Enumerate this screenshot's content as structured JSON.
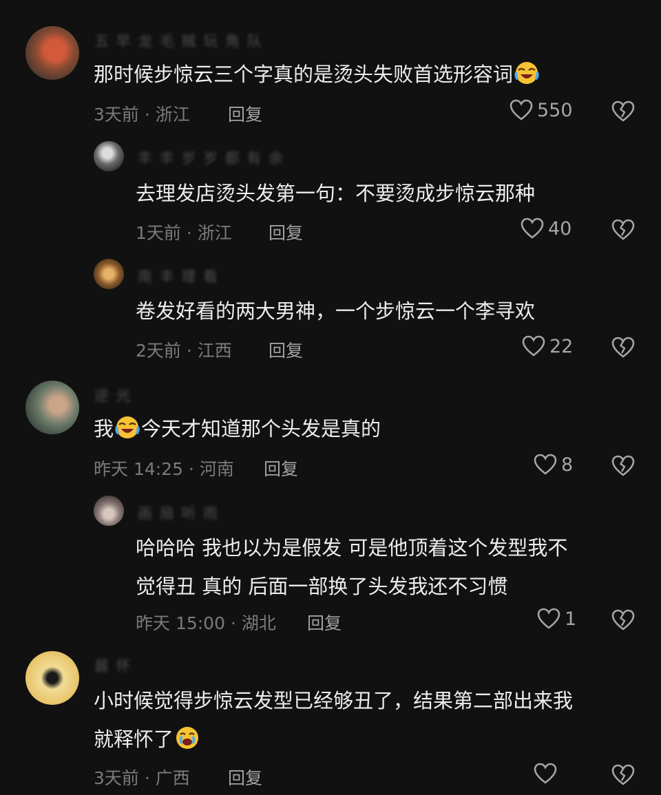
{
  "comments": [
    {
      "username": "五 早 龙 毛 贼 玩 角 队",
      "text": "那时候步惊云三个字真的是烫头失败首选形容词",
      "emoji": "laughing-crying-emoji",
      "time": "3天前 · 浙江",
      "reply": "回复",
      "likes": "550"
    },
    {
      "username": "丰 丰 岁 岁 都 有 余",
      "text": "去理发店烫头发第一句：不要烫成步惊云那种",
      "time": "1天前 · 浙江",
      "reply": "回复",
      "likes": "40"
    },
    {
      "username": "南 丰 理 看",
      "text": "卷发好看的两大男神，一个步惊云一个李寻欢",
      "time": "2天前 · 江西",
      "reply": "回复",
      "likes": "22"
    },
    {
      "username": "逆 光",
      "text_before": "我",
      "emoji": "laughing-crying-emoji",
      "text_after": "今天才知道那个头发是真的",
      "time": "昨天 14:25 · 河南",
      "reply": "回复",
      "likes": "8"
    },
    {
      "username": "画 扇 听 雨",
      "text_line1": "哈哈哈 我也以为是假发 可是他顶着这个发型我不",
      "text_line2": "觉得丑 真的 后面一部换了头发我还不习惯",
      "time": "昨天 15:00 · 湖北",
      "reply": "回复",
      "likes": "1"
    },
    {
      "username": "晨 怀",
      "text_line1": "小时候觉得步惊云发型已经够丑了，结果第二部出来我",
      "text_line2": "就释怀了",
      "emoji": "crying-laughing-emoji",
      "time": "3天前 · 广西",
      "reply": "回复"
    }
  ],
  "colors": {
    "background": "#111111",
    "text": "#ededed",
    "meta": "#7b7b7b",
    "icon": "#a6a6a6"
  }
}
